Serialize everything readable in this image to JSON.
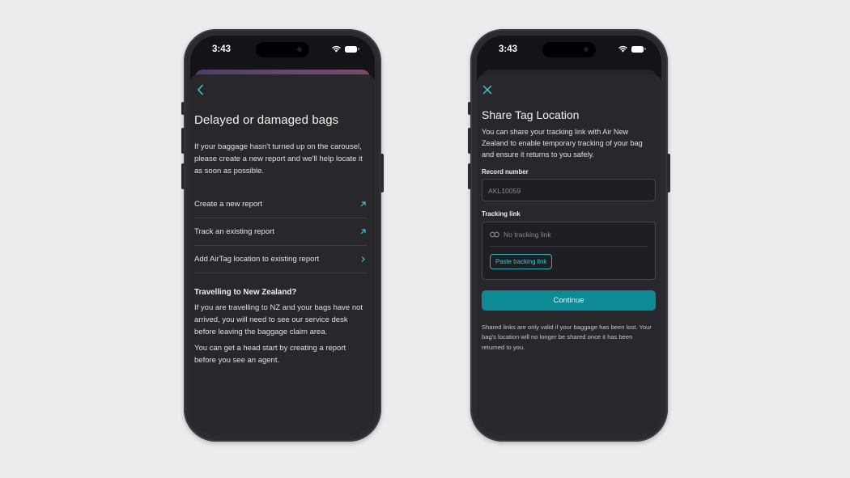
{
  "status": {
    "time": "3:43"
  },
  "left_screen": {
    "title": "Delayed or damaged bags",
    "intro": "If your baggage hasn't turned up on the carousel, please create a new report and we'll help locate it as soon as possible.",
    "options": [
      {
        "label": "Create a new report",
        "icon": "arrow-up-right-icon"
      },
      {
        "label": "Track an existing report",
        "icon": "arrow-up-right-icon"
      },
      {
        "label": "Add AirTag location to existing report",
        "icon": "chevron-right-icon"
      }
    ],
    "nz_section": {
      "title": "Travelling to New Zealand?",
      "para1": "If you are travelling to NZ and your bags have not arrived, you will need to see our service desk before leaving the baggage claim area.",
      "para2": "You can get a head start by creating a report before you see an agent."
    }
  },
  "right_screen": {
    "title": "Share Tag Location",
    "intro": "You can share your tracking link with Air New Zealand to enable temporary tracking of your bag and ensure it returns to you safely.",
    "record_label": "Record number",
    "record_placeholder": "AKL10059",
    "tracking_label": "Tracking link",
    "tracking_empty": "No tracking link",
    "paste_label": "Paste tracking link",
    "continue_label": "Continue",
    "footnote": "Shared links are only valid if your baggage has been lost. Your bag's location will no longer be shared once it has been returned to you."
  },
  "colors": {
    "accent": "#0d8a96",
    "accent_text": "#3ec6d3",
    "sheet_bg": "#28272c",
    "page_bg": "#ececec"
  }
}
